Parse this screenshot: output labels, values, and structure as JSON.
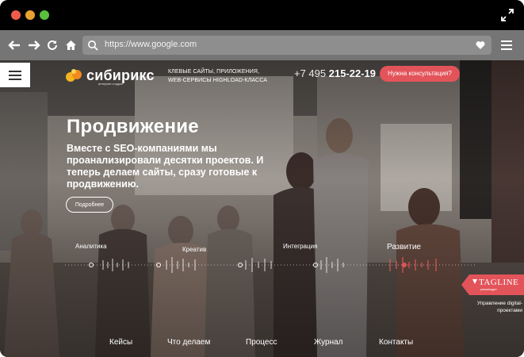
{
  "browser": {
    "url": "https://www.google.com",
    "controls": [
      "close",
      "minimize",
      "maximize"
    ],
    "colors": {
      "close": "#ee5b4c",
      "minimize": "#e9a232",
      "maximize": "#59c13e",
      "toolbar": "#757575"
    }
  },
  "site": {
    "brand": "сибирикс",
    "brand_sub": "интернет-студия",
    "description": "Клевые сайты, приложения, web-сервисы highload-класса",
    "phone_prefix": "+7 495",
    "phone_number": "215-22-19",
    "consult_button": "Нужна консультация?",
    "accent_color": "#e2545a"
  },
  "hero": {
    "title": "Продвижение",
    "text": "Вместе с SEO-компаниями мы проанализировали десятки проектов. И теперь делаем сайты, сразу готовые к продвижению.",
    "button": "Подробнее"
  },
  "timeline": {
    "stages": [
      "Аналитика",
      "Креатив",
      "Интеграция",
      "Развитие"
    ],
    "active_stage": "Развитие"
  },
  "tagline": {
    "badge": "TAGLINE",
    "badge_sub": "рекомендует",
    "caption": "Управление digital-проектами"
  },
  "nav": [
    "Кейсы",
    "Что делаем",
    "Процесс",
    "Журнал",
    "Контакты"
  ]
}
